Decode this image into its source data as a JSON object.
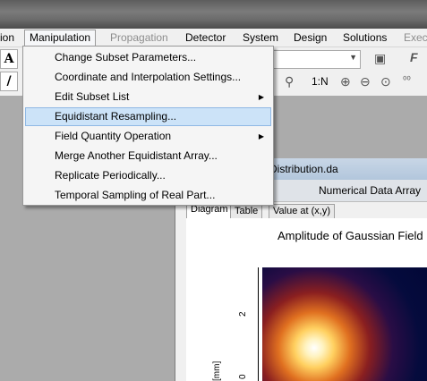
{
  "menubar": {
    "items": [
      {
        "label": "ion"
      },
      {
        "label": "Manipulation"
      },
      {
        "label": "Propagation"
      },
      {
        "label": "Detector"
      },
      {
        "label": "System"
      },
      {
        "label": "Design"
      },
      {
        "label": "Solutions"
      },
      {
        "label": "Execu"
      }
    ]
  },
  "toolbar": {
    "zoom_label": "1:N"
  },
  "dropdown": {
    "items": [
      {
        "label": "Change Subset Parameters..."
      },
      {
        "label": "Coordinate and Interpolation Settings..."
      },
      {
        "label": "Edit Subset List"
      },
      {
        "label": "Equidistant Resampling..."
      },
      {
        "label": "Field Quantity Operation"
      },
      {
        "label": "Merge Another Equidistant Array..."
      },
      {
        "label": "Replicate Periodically..."
      },
      {
        "label": "Temporal Sampling of Real Part..."
      }
    ]
  },
  "document": {
    "title": "Distribution.da",
    "subtitle": "Numerical Data Array",
    "tabs": [
      {
        "label": "Diagram"
      },
      {
        "label": "Table"
      },
      {
        "label": "Value at (x,y)"
      }
    ],
    "plot_title": "Amplitude of Gaussian Field",
    "ylabel": "[mm]",
    "yticks": [
      "2",
      "0"
    ]
  },
  "colors": {
    "highlight": "#cce3f8",
    "disabled_text": "#8d8d8d"
  }
}
